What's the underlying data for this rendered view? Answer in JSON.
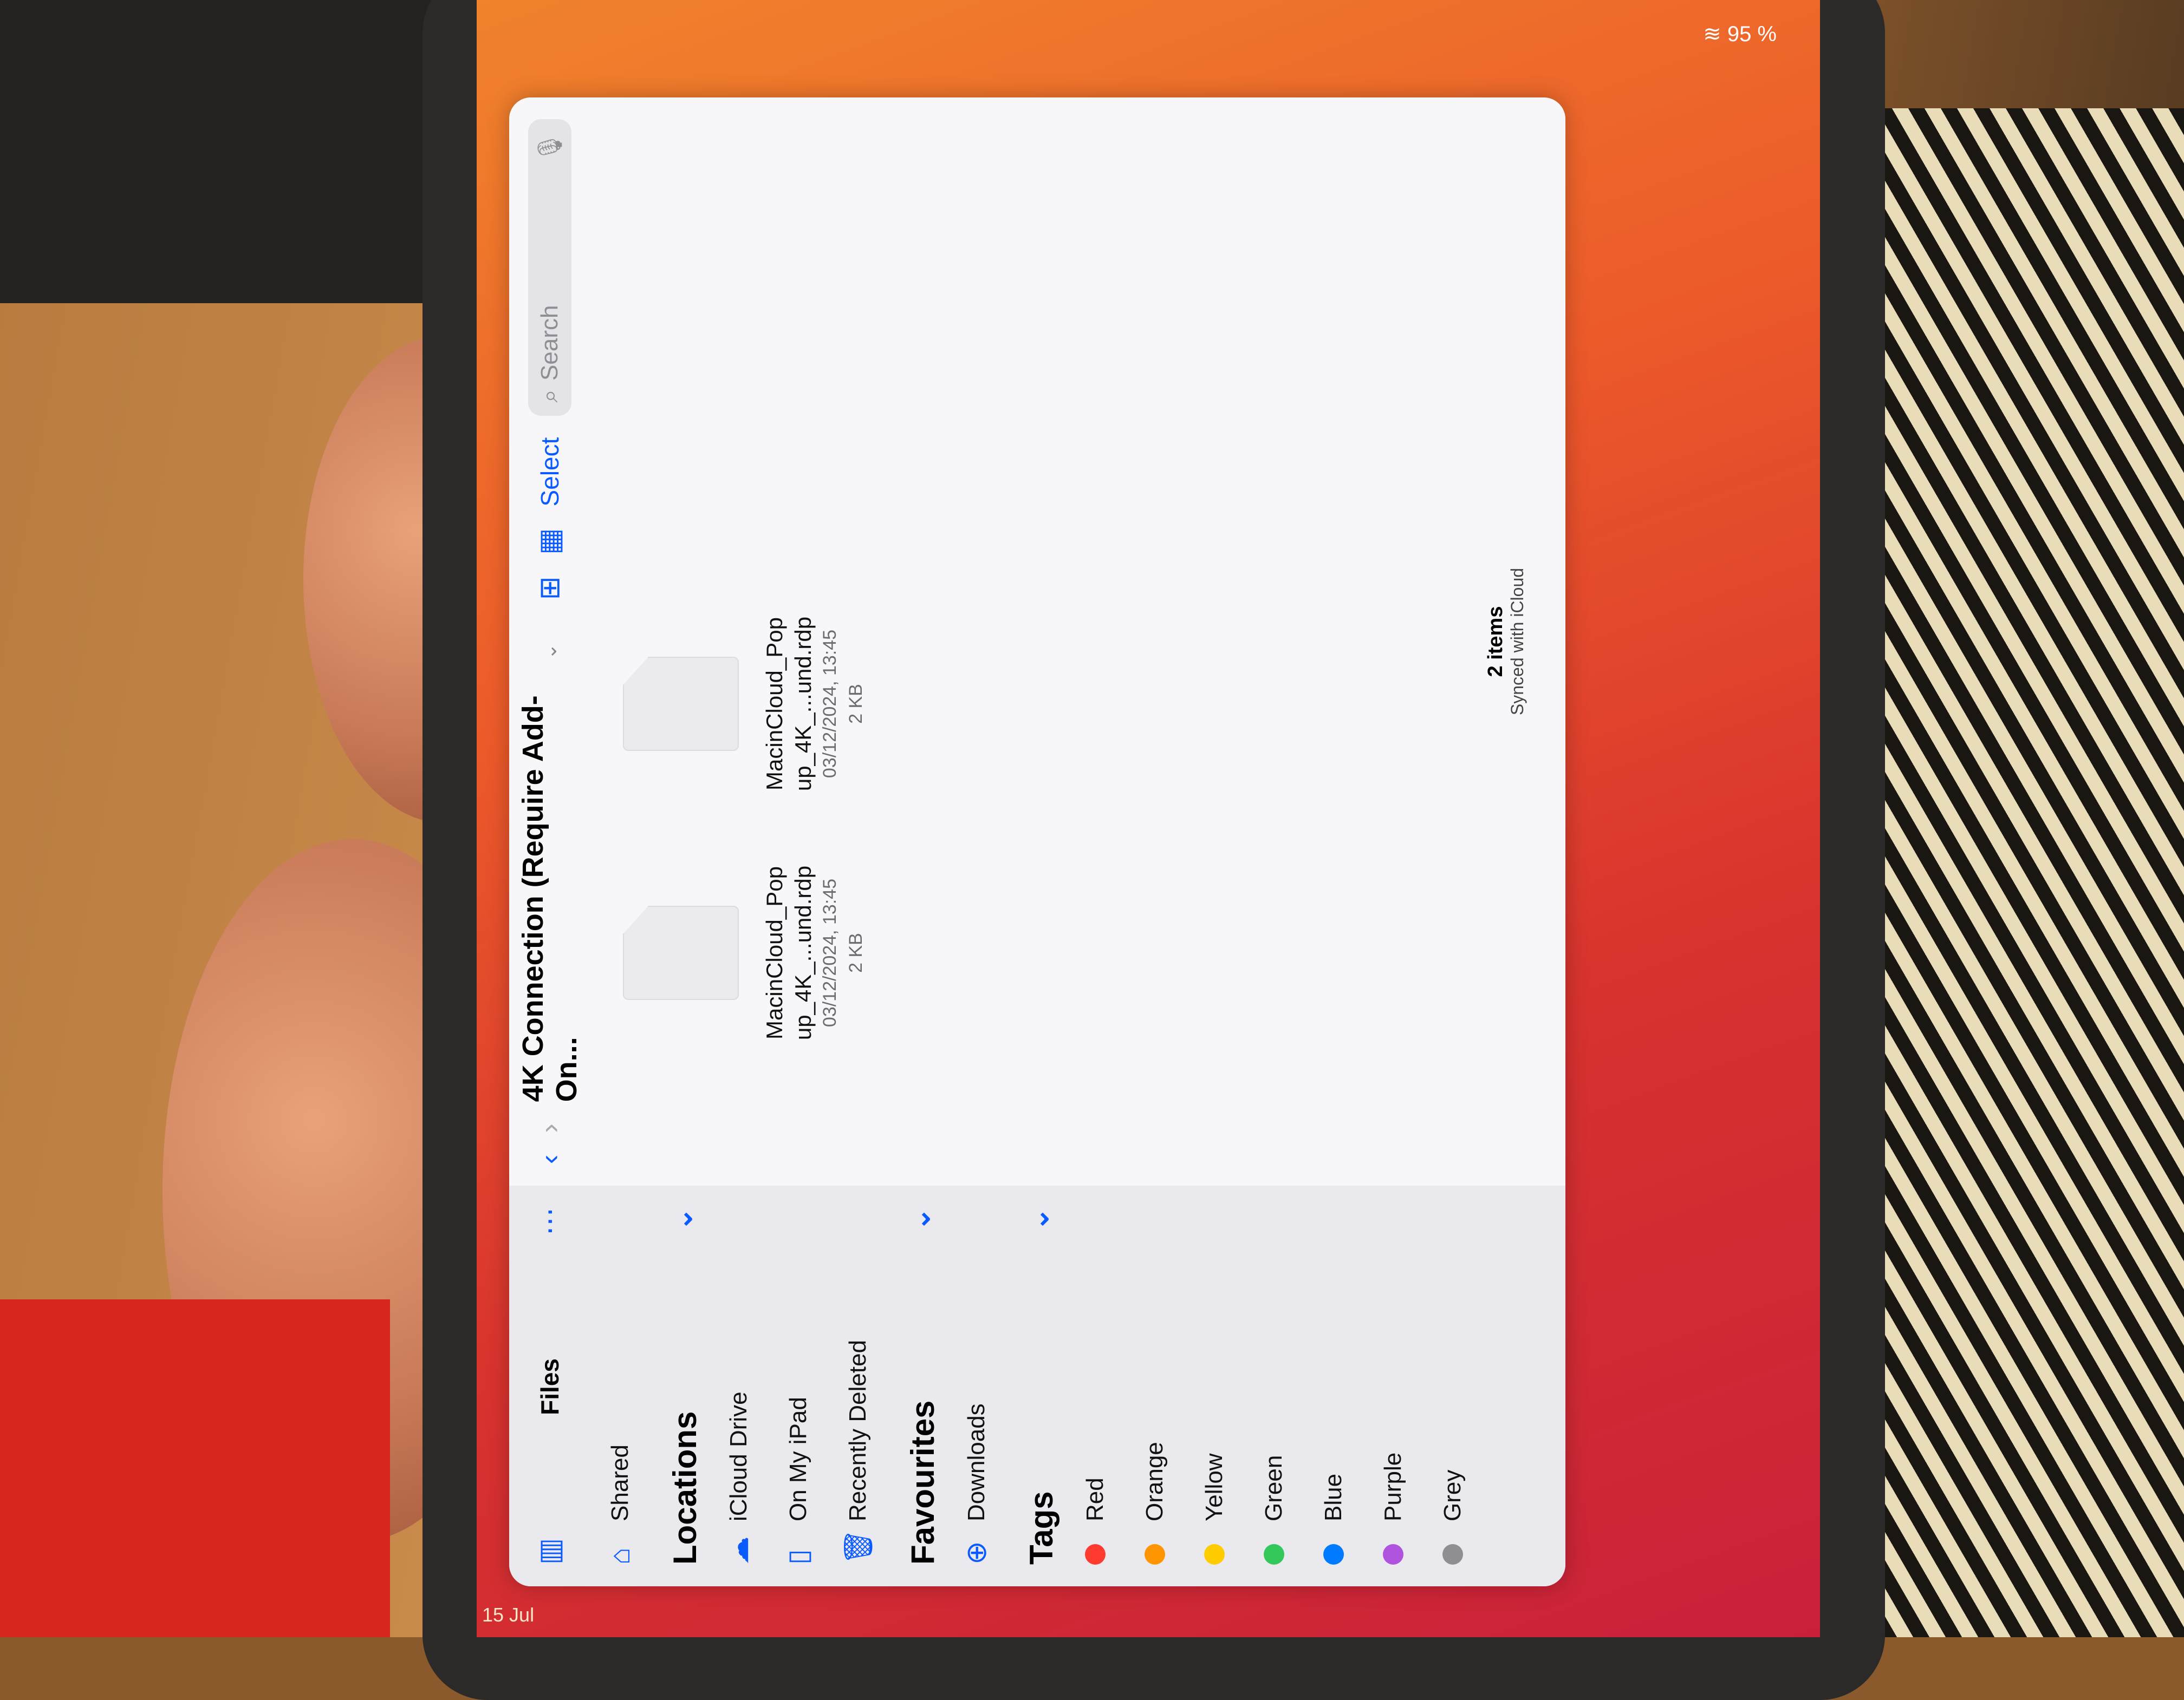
{
  "status": {
    "battery": "95 %",
    "date": "15 Jul"
  },
  "sidebar": {
    "app_title": "Files",
    "shared": "Shared",
    "locations_title": "Locations",
    "locations": [
      {
        "label": "iCloud Drive",
        "icon": "cloud-icon"
      },
      {
        "label": "On My iPad",
        "icon": "ipad-icon"
      },
      {
        "label": "Recently Deleted",
        "icon": "trash-icon"
      }
    ],
    "favourites_title": "Favourites",
    "favourites": [
      {
        "label": "Downloads",
        "icon": "download-icon"
      }
    ],
    "tags_title": "Tags",
    "tags": [
      {
        "label": "Red",
        "color": "#ff3b30"
      },
      {
        "label": "Orange",
        "color": "#ff9500"
      },
      {
        "label": "Yellow",
        "color": "#ffcc00"
      },
      {
        "label": "Green",
        "color": "#34c759"
      },
      {
        "label": "Blue",
        "color": "#007aff"
      },
      {
        "label": "Purple",
        "color": "#af52de"
      },
      {
        "label": "Grey",
        "color": "#8e8e93"
      }
    ]
  },
  "toolbar": {
    "title": "4K Connection (Require Add-On...",
    "select_label": "Select",
    "search_placeholder": "Search"
  },
  "files": [
    {
      "name_line1": "MacinCloud_Pop",
      "name_line2": "up_4K_...und.rdp",
      "date": "03/12/2024, 13:45",
      "size": "2 KB"
    },
    {
      "name_line1": "MacinCloud_Pop",
      "name_line2": "up_4K_...und.rdp",
      "date": "03/12/2024, 13:45",
      "size": "2 KB"
    }
  ],
  "footer": {
    "count": "2 items",
    "sync": "Synced with iCloud"
  },
  "dock": [
    "safari-icon",
    "music-icon",
    "mail-icon",
    "files-icon",
    "youtube-icon",
    "github-icon",
    "app-store-icon",
    "app-library-icon"
  ],
  "accent_color": "#0a5bff"
}
